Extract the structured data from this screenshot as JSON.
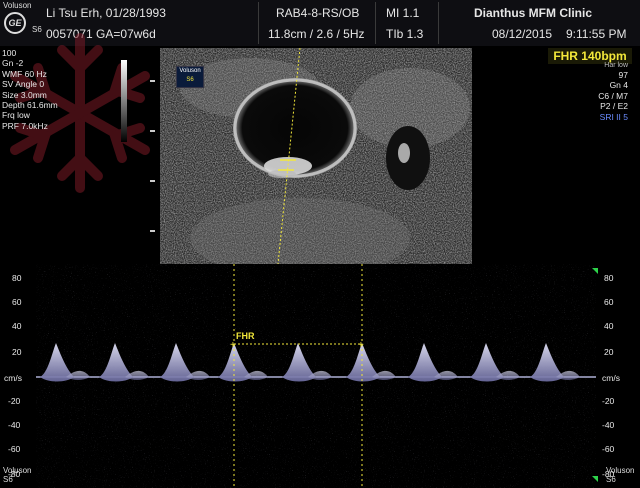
{
  "header": {
    "brand_line1": "Voluson",
    "brand_line2": "S6",
    "patient_name": "Li Tsu Erh,  01/28/1993",
    "patient_id": "0057071  GA=07w6d",
    "probe": "RAB4-8-RS/OB",
    "depth_info": "11.8cm / 2.6 /  5Hz",
    "mi": "MI  1.1",
    "tib": "TIb  1.3",
    "clinic": "Dianthus MFM Clinic",
    "date": "08/12/2015",
    "time": "9:11:55 PM"
  },
  "left_params": [
    "100",
    "Gn  -2",
    "WMF 60 Hz",
    "SV Angle  0",
    "Size  3.0mm",
    "Depth 61.6mm",
    "Frq low",
    "PRF  7.0kHz"
  ],
  "right_params": {
    "fhr": "FHR 140bpm",
    "partial": "Har low",
    "lines": [
      "97",
      "Gn  4",
      "C6 / M7",
      "P2 / E2"
    ],
    "sri": "SRI II 5"
  },
  "image_logo": {
    "line1": "Voluson",
    "line2": "S6"
  },
  "spectrum": {
    "left_ticks": [
      "80",
      "60",
      "40",
      "20",
      "cm/s",
      "-20",
      "-40",
      "-60",
      "-80"
    ],
    "right_ticks": [
      "80",
      "60",
      "40",
      "20",
      "cm/s",
      "-20",
      "-40",
      "-60",
      "-80"
    ],
    "caliper_label": "FHR"
  },
  "footer": {
    "brand_line1": "Voluson",
    "brand_line2": "S6"
  },
  "colors": {
    "accent_yellow": "#f3e83a",
    "sri_blue": "#6b8cff"
  }
}
